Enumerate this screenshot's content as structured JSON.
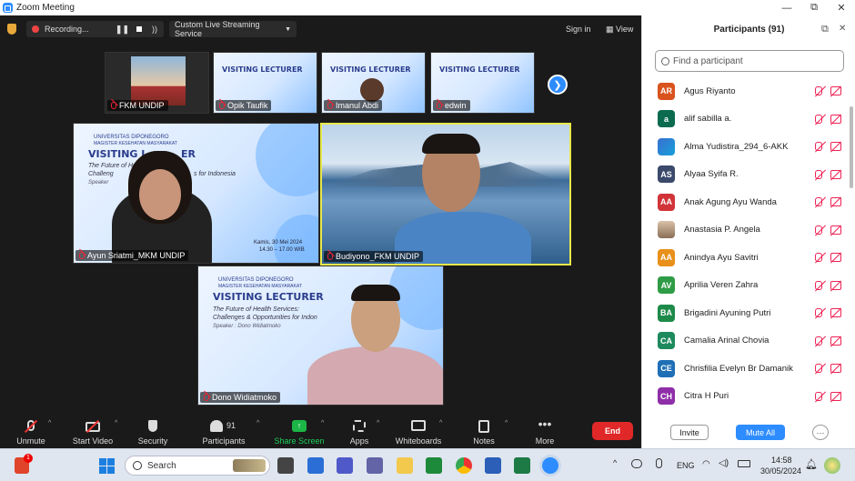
{
  "window": {
    "title": "Zoom Meeting",
    "controls": [
      "—",
      "⧉",
      "✕"
    ]
  },
  "topbar": {
    "recording_label": "Recording...",
    "live_stream_label": "Custom Live Streaming Service",
    "signin_label": "Sign in",
    "view_label": "View"
  },
  "strip_tiles": [
    {
      "name": "FKM UNDIP"
    },
    {
      "name": "Opik Taufik"
    },
    {
      "name": "Imanul Abdi"
    },
    {
      "name": "edwin"
    }
  ],
  "slide": {
    "university": "UNIVERSITAS DIPONEGORO",
    "program": "MAGISTER KESEHATAN MASYARAKAT",
    "title": "VISITING LECTURER",
    "subtitle_1": "The Future of Health Services:",
    "subtitle_2": "Challenges & Opportunities for Indonesia",
    "subtitle_2_cropped": "Challenges & Opportunities for Indon",
    "subtitle_2_partial": "Challeng",
    "subtitle_2_tail": "s for Indonesia",
    "speaker": "Speaker : Dono Widiatmoko",
    "speaker_short": "Speaker",
    "date": "Kamis, 30 Mei 2024",
    "time": "14.30 – 17.00 WIB",
    "title_short": "VISITING L",
    "title_tail": "ER"
  },
  "gallery": [
    {
      "name": "Ayun Sriatmi_MKM UNDIP"
    },
    {
      "name": "Budiyono_FKM UNDIP"
    },
    {
      "name": "Dono Widiatmoko"
    }
  ],
  "toolbar": {
    "unmute": "Unmute",
    "start_video": "Start Video",
    "security": "Security",
    "participants": "Participants",
    "participants_count": "91",
    "share_screen": "Share Screen",
    "apps": "Apps",
    "whiteboards": "Whiteboards",
    "notes": "Notes",
    "more": "More",
    "end": "End"
  },
  "panel": {
    "title": "Participants (91)",
    "search_placeholder": "Find a participant",
    "participants": [
      {
        "initials": "AR",
        "name": "Agus Riyanto",
        "color": "#d9531e"
      },
      {
        "initials": "a",
        "name": "alif sabilla a.",
        "color": "#0b6b4f"
      },
      {
        "initials": "",
        "name": "Alma Yudistira_294_6-AKK",
        "color": "#3a6fd0"
      },
      {
        "initials": "AS",
        "name": "Alyaa Syifa R.",
        "color": "#3b4a6b"
      },
      {
        "initials": "AA",
        "name": "Anak Agung Ayu Wanda",
        "color": "#d13438"
      },
      {
        "initials": "",
        "name": "Anastasia P. Angela",
        "color": "#b59a7a"
      },
      {
        "initials": "AA",
        "name": "Anindya Ayu Savitri",
        "color": "#e8901a"
      },
      {
        "initials": "AV",
        "name": "Aprilia Veren Zahra",
        "color": "#2e9c46"
      },
      {
        "initials": "BA",
        "name": "Brigadini Ayuning Putri",
        "color": "#1e8a4a"
      },
      {
        "initials": "CA",
        "name": "Camalia Arinal Chovia",
        "color": "#1d8a5e"
      },
      {
        "initials": "CE",
        "name": "Chrisfilia Evelyn Br Damanik",
        "color": "#1f6fb5"
      },
      {
        "initials": "CH",
        "name": "Citra H Puri",
        "color": "#8e2fa8"
      }
    ],
    "invite_label": "Invite",
    "mute_all_label": "Mute All",
    "more_label": "···"
  },
  "taskbar": {
    "search_label": "Search",
    "lang": "ENG",
    "time": "14:58",
    "date": "30/05/2024",
    "notif_count": "1"
  },
  "colors": {
    "accent": "#2d8cff",
    "end": "#e02828",
    "active_speaker": "#e8e84a"
  }
}
